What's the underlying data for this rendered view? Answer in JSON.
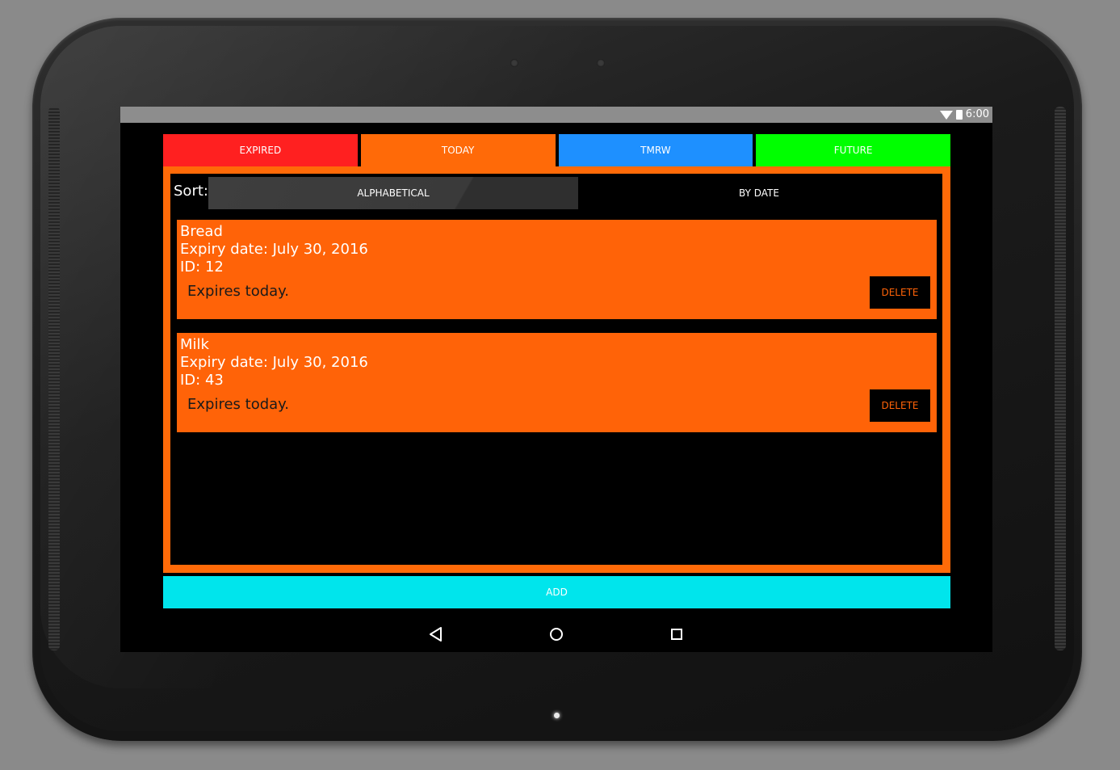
{
  "status_bar": {
    "time": "6:00"
  },
  "tabs": [
    {
      "label": "EXPIRED",
      "color": "#ff2020"
    },
    {
      "label": "TODAY",
      "color": "#ff6a08"
    },
    {
      "label": "TMRW",
      "color": "#1e90ff"
    },
    {
      "label": "FUTURE",
      "color": "#00ff00"
    }
  ],
  "sort": {
    "label": "Sort:",
    "options": [
      "ALPHABETICAL",
      "BY DATE"
    ],
    "selected": "ALPHABETICAL"
  },
  "items": [
    {
      "name": "Bread",
      "expiry": "Expiry date: July 30, 2016",
      "id": "ID: 12",
      "status": "Expires today.",
      "delete_label": "DELETE"
    },
    {
      "name": "Milk",
      "expiry": "Expiry date: July 30, 2016",
      "id": "ID: 43",
      "status": "Expires today.",
      "delete_label": "DELETE"
    }
  ],
  "add_label": "ADD",
  "nav": {
    "icons": [
      "back-icon",
      "home-icon",
      "recents-icon"
    ]
  },
  "colors": {
    "panel": "#ff6a08",
    "card": "#ff6308",
    "add": "#00e5ec"
  }
}
